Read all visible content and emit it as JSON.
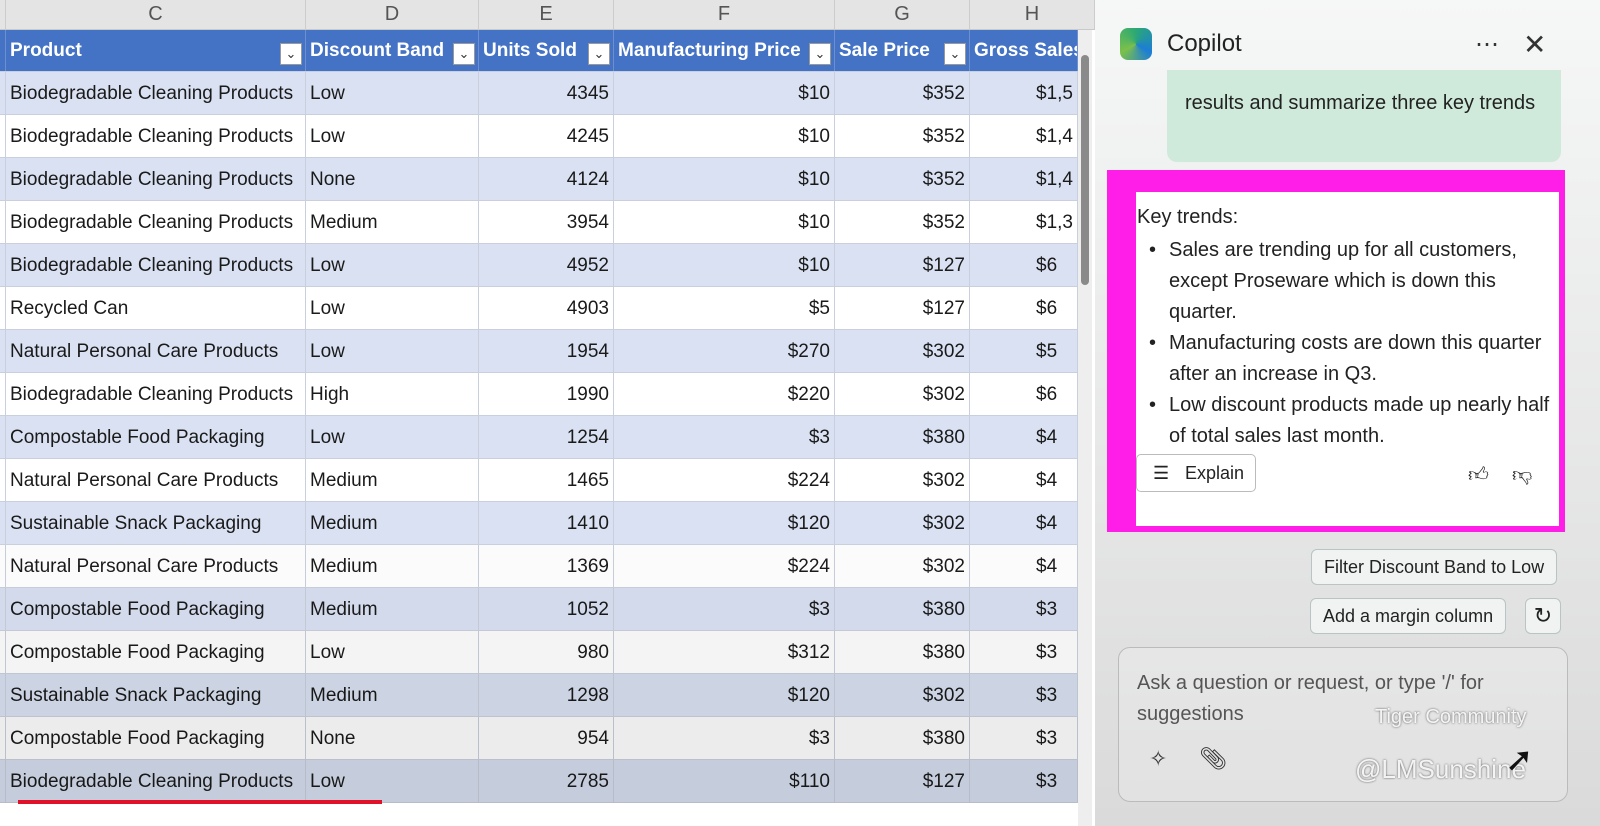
{
  "columns": [
    "C",
    "D",
    "E",
    "F",
    "G",
    "H"
  ],
  "headers": [
    "Product",
    "Discount Band",
    "Units Sold",
    "Manufacturing Price",
    "Sale Price",
    "Gross Sales"
  ],
  "rows": [
    [
      "Biodegradable Cleaning Products",
      "Low",
      "4345",
      "$10",
      "$352",
      "$1,5"
    ],
    [
      "Biodegradable Cleaning Products",
      "Low",
      "4245",
      "$10",
      "$352",
      "$1,4"
    ],
    [
      "Biodegradable Cleaning Products",
      "None",
      "4124",
      "$10",
      "$352",
      "$1,4"
    ],
    [
      "Biodegradable Cleaning Products",
      "Medium",
      "3954",
      "$10",
      "$352",
      "$1,3"
    ],
    [
      "Biodegradable Cleaning Products",
      "Low",
      "4952",
      "$10",
      "$127",
      "$6"
    ],
    [
      "Recycled Can",
      "Low",
      "4903",
      "$5",
      "$127",
      "$6"
    ],
    [
      "Natural Personal Care Products",
      "Low",
      "1954",
      "$270",
      "$302",
      "$5"
    ],
    [
      "Biodegradable Cleaning Products",
      "High",
      "1990",
      "$220",
      "$302",
      "$6"
    ],
    [
      "Compostable Food Packaging",
      "Low",
      "1254",
      "$3",
      "$380",
      "$4"
    ],
    [
      "Natural Personal Care Products",
      "Medium",
      "1465",
      "$224",
      "$302",
      "$4"
    ],
    [
      "Sustainable Snack Packaging",
      "Medium",
      "1410",
      "$120",
      "$302",
      "$4"
    ],
    [
      "Natural Personal Care Products",
      "Medium",
      "1369",
      "$224",
      "$302",
      "$4"
    ],
    [
      "Compostable Food Packaging",
      "Medium",
      "1052",
      "$3",
      "$380",
      "$3"
    ],
    [
      "Compostable Food Packaging",
      "Low",
      "980",
      "$312",
      "$380",
      "$3"
    ],
    [
      "Sustainable Snack Packaging",
      "Medium",
      "1298",
      "$120",
      "$302",
      "$3"
    ],
    [
      "Compostable Food Packaging",
      "None",
      "954",
      "$3",
      "$380",
      "$3"
    ],
    [
      "Biodegradable Cleaning Products",
      "Low",
      "2785",
      "$110",
      "$127",
      "$3"
    ]
  ],
  "copilot": {
    "title": "Copilot",
    "user_message": "results and summarize three key trends",
    "response_heading": "Key trends:",
    "trends": [
      "Sales are trending up for all customers, except Proseware which is down this quarter.",
      "Manufacturing costs are down this quarter after an increase in Q3.",
      "Low discount products made up nearly half of total sales last month."
    ],
    "explain_label": "Explain",
    "suggestions": [
      "Filter Discount Band to Low",
      "Add a margin column"
    ],
    "input_placeholder": "Ask a question or request, or type '/' for suggestions"
  },
  "watermarks": {
    "community": "Tiger Community",
    "handle": "@LMSunshine"
  },
  "colors": {
    "header": "#4472c4",
    "highlight": "#ff1ee8",
    "band": "#d9e1f2"
  }
}
